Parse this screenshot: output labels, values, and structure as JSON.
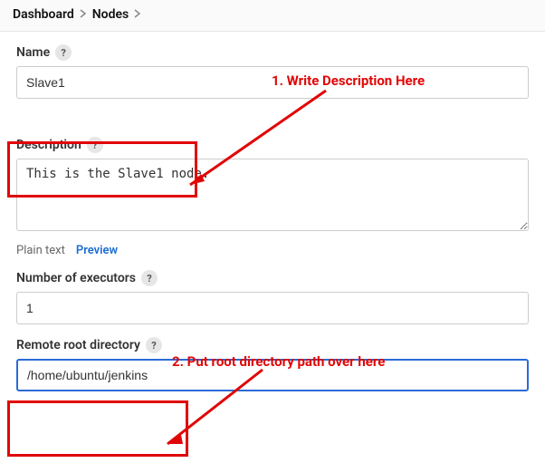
{
  "breadcrumb": {
    "items": [
      {
        "label": "Dashboard"
      },
      {
        "label": "Nodes"
      }
    ],
    "trailing_separator": true
  },
  "name": {
    "label": "Name",
    "value": "Slave1"
  },
  "description": {
    "label": "Description",
    "value": "This is the Slave1 node."
  },
  "desc_tabs": {
    "plain": "Plain text",
    "preview": "Preview"
  },
  "executors": {
    "label": "Number of executors",
    "value": "1"
  },
  "remote_root": {
    "label": "Remote root directory",
    "value": "/home/ubuntu/jenkins"
  },
  "help_glyph": "?",
  "annotations": {
    "a1": "1. Write Description Here",
    "a2": "2. Put root directory path over here"
  },
  "colors": {
    "annotation": "#e10606",
    "accent": "#1a6dd6"
  }
}
